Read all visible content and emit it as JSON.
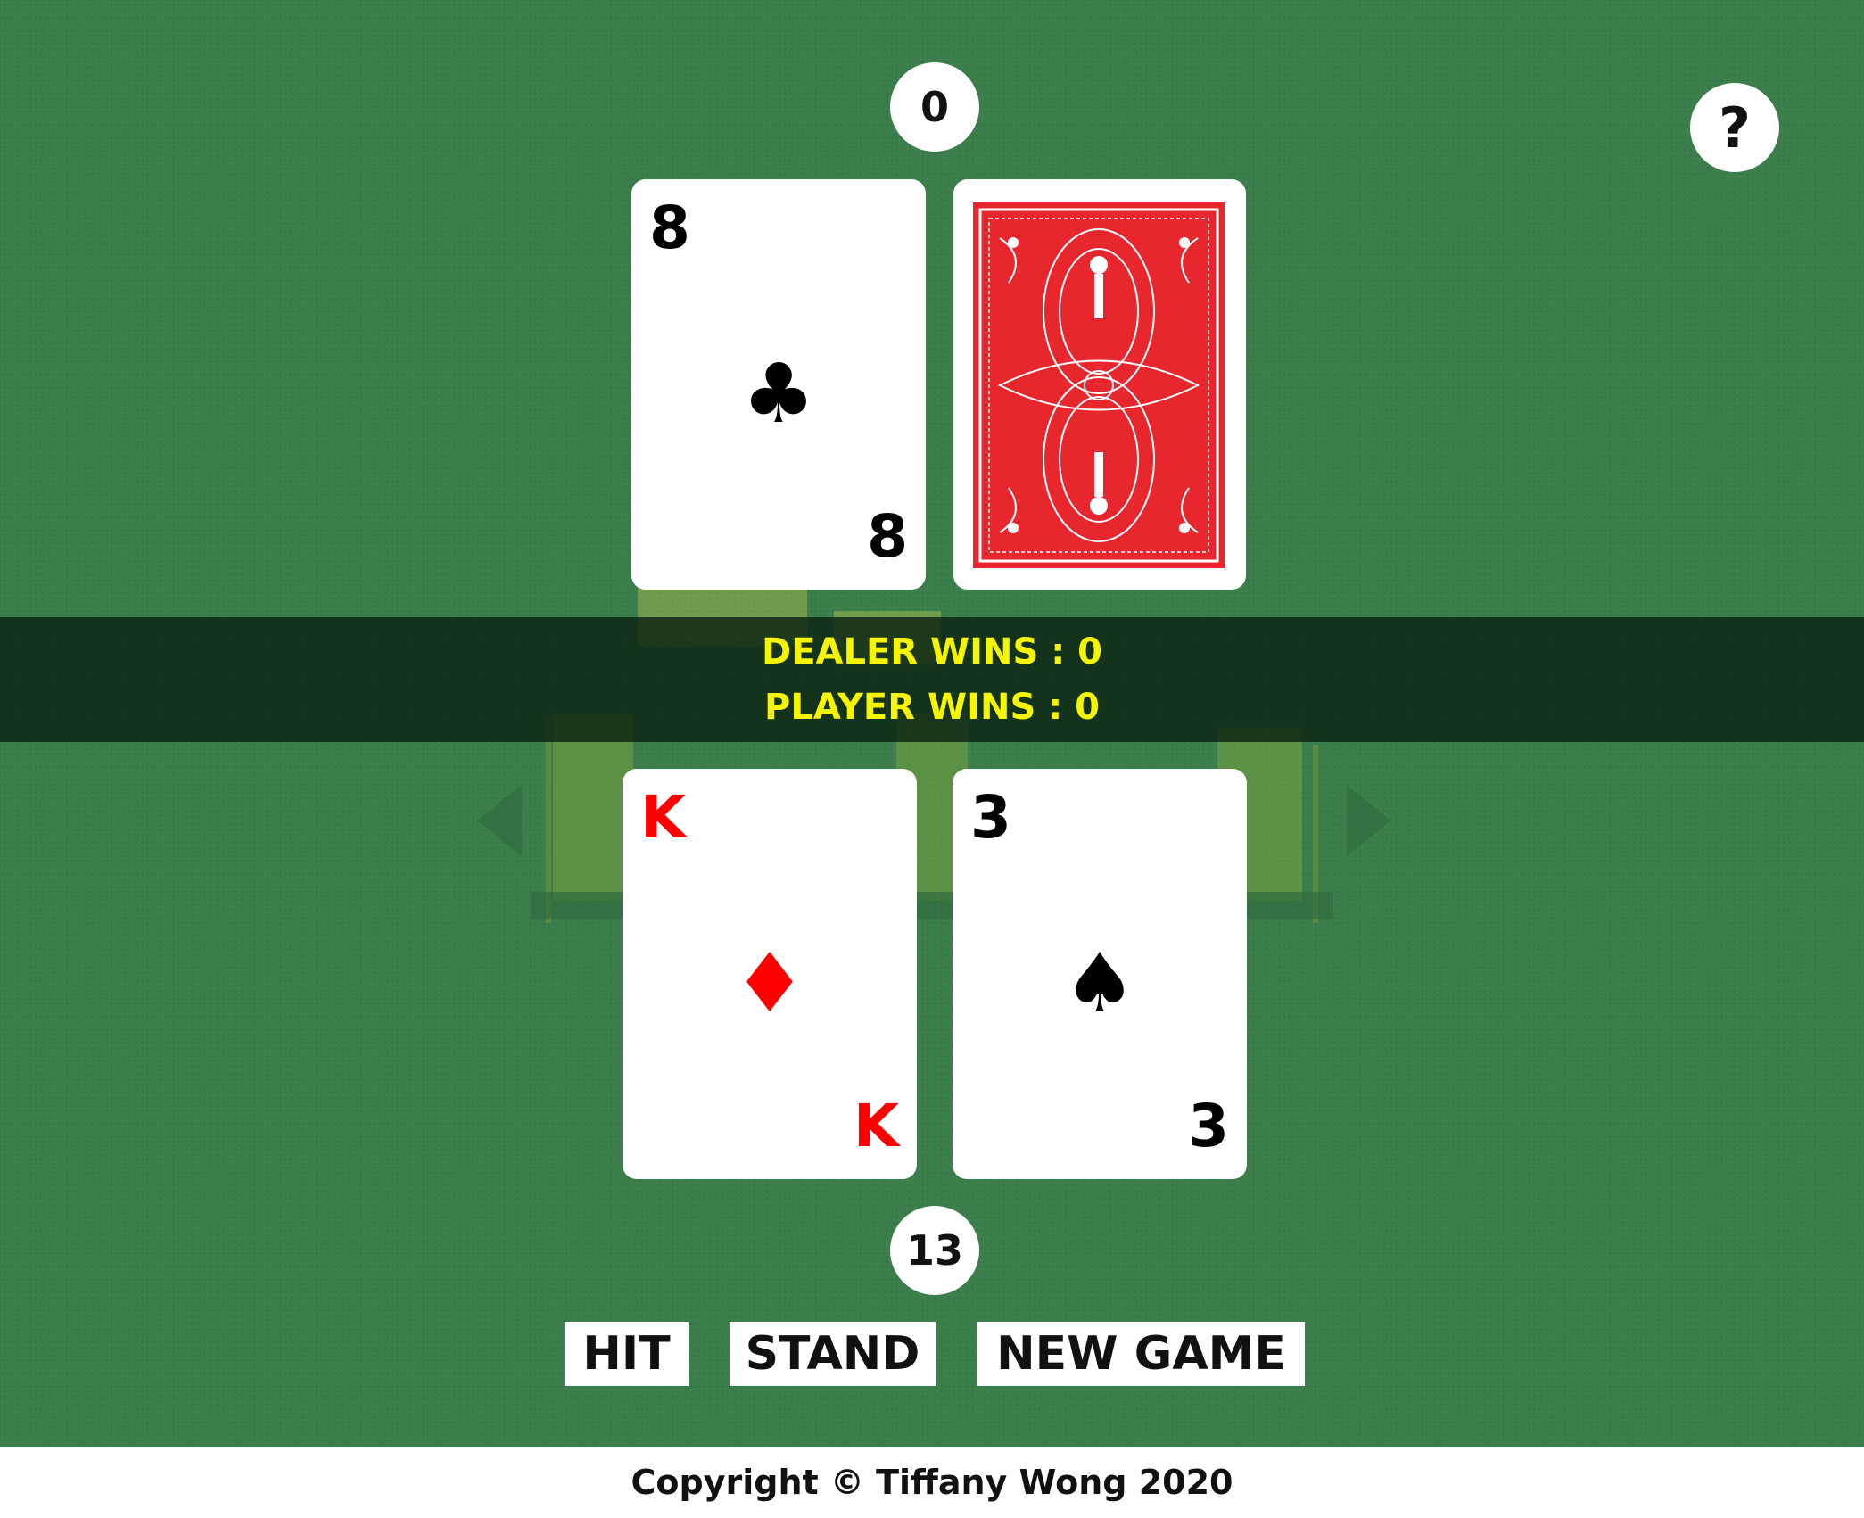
{
  "dealer": {
    "score": "0",
    "cards": [
      {
        "rank": "8",
        "suit": "♣",
        "color": "#000000"
      },
      {
        "face_down": true
      }
    ]
  },
  "player": {
    "score": "13",
    "cards": [
      {
        "rank": "K",
        "suit": "♦",
        "color": "#ff0000"
      },
      {
        "rank": "3",
        "suit": "♠",
        "color": "#000000"
      }
    ]
  },
  "scoreboard": {
    "dealer_wins": "DEALER WINS : 0",
    "player_wins": "PLAYER WINS : 0"
  },
  "help": {
    "label": "?"
  },
  "controls": {
    "hit": "HIT",
    "stand": "STAND",
    "new_game": "NEW GAME"
  },
  "footer": {
    "copyright": "Copyright © Tiffany Wong 2020"
  },
  "colors": {
    "table_green": "#3b7d4b",
    "wins_text": "#f5f500",
    "card_back_red": "#e8262e"
  }
}
